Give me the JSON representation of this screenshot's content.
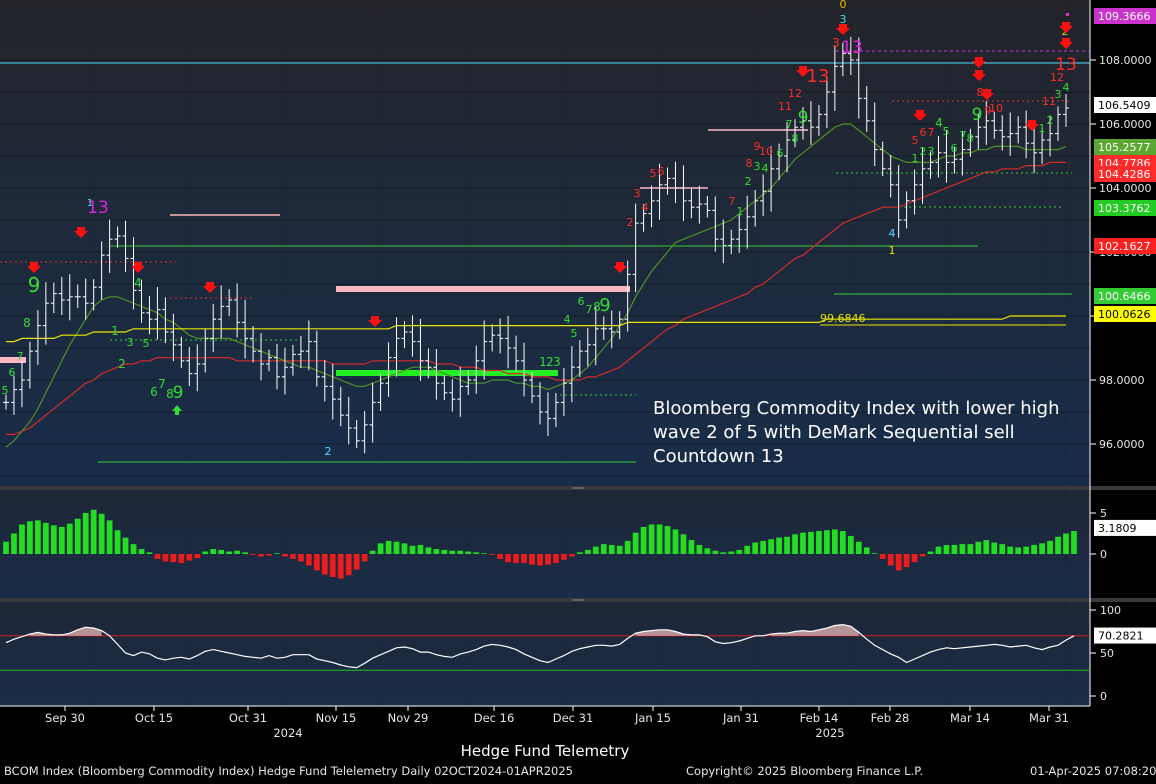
{
  "chart_data": [
    {
      "type": "line",
      "panel": "price",
      "title": "",
      "annotation": "Bloomberg Commodity Index with lower high wave 2 of 5 with DeMark Sequential sell Countdown 13",
      "ylim": [
        95.2,
        110.0
      ],
      "yticks": [
        "96.0000",
        "98.0000",
        "100.0000",
        "102.0000",
        "104.0000",
        "106.0000",
        "108.0000"
      ],
      "price_labels": [
        {
          "value": 109.3666,
          "text": "109.3666",
          "color": "#cc33cc"
        },
        {
          "value": 106.5409,
          "text": "106.5409",
          "color": "#ffffff"
        },
        {
          "value": 105.2577,
          "text": "105.2577",
          "color": "#5aa832"
        },
        {
          "value": 104.7786,
          "text": "104.7786",
          "color": "#ff2a2a"
        },
        {
          "value": 104.4286,
          "text": "104.4286",
          "color": "#ff2a2a"
        },
        {
          "value": 103.3762,
          "text": "103.3762",
          "color": "#22cc22"
        },
        {
          "value": 102.1627,
          "text": "102.1627",
          "color": "#ff2020"
        },
        {
          "value": 100.6466,
          "text": "100.6466",
          "color": "#33cc33"
        },
        {
          "value": 100.0626,
          "text": "100.0626",
          "color": "#ffff00"
        }
      ],
      "inline_label": "99.6846",
      "series": [
        {
          "name": "",
          "color": "#ffffff",
          "values": [
            97.3,
            97.7,
            98.0,
            98.9,
            99.7,
            100.4,
            100.7,
            100.5,
            100.6,
            100.6,
            100.4,
            100.9,
            101.9,
            102.4,
            102.5,
            101.8,
            100.8,
            100.1,
            99.9,
            100.2,
            99.5,
            99.1,
            98.6,
            98.2,
            98.5,
            99.3,
            99.9,
            100.3,
            100.5,
            99.8,
            99.3,
            98.9,
            98.5,
            98.7,
            98.1,
            98.4,
            98.8,
            98.9,
            99.2,
            98.1,
            97.8,
            97.4,
            96.9,
            96.5,
            96.1,
            96.6,
            97.3,
            97.9,
            98.7,
            99.3,
            99.5,
            99.2,
            98.6,
            98.4,
            97.9,
            97.6,
            97.4,
            97.8,
            98.0,
            98.6,
            99.2,
            99.4,
            99.3,
            99.0,
            98.6,
            98.0,
            97.5,
            97.0,
            96.8,
            97.3,
            97.9,
            98.4,
            98.9,
            99.1,
            99.6,
            99.6,
            99.5,
            99.9,
            101.3,
            102.9,
            103.2,
            103.6,
            104.1,
            104.3,
            104.0,
            103.6,
            103.4,
            103.5,
            103.3,
            102.4,
            102.2,
            102.4,
            102.7,
            103.1,
            103.6,
            103.9,
            104.6,
            105.0,
            105.5,
            105.9,
            106.1,
            105.9,
            106.3,
            107.0,
            107.8,
            108.2,
            108.0,
            106.8,
            106.1,
            105.2,
            104.6,
            104.1,
            103.0,
            103.6,
            104.1,
            104.6,
            104.8,
            105.1,
            104.8,
            104.9,
            105.2,
            105.6,
            105.9,
            106.1,
            105.8,
            105.6,
            105.7,
            105.9,
            105.4,
            105.1,
            105.5,
            105.7,
            106.3,
            106.5
          ]
        },
        {
          "name": "",
          "color": "#d32b2b",
          "values": [
            96.3,
            96.3,
            96.4,
            96.5,
            96.7,
            96.9,
            97.1,
            97.3,
            97.5,
            97.7,
            97.9,
            98.0,
            98.2,
            98.3,
            98.4,
            98.5,
            98.5,
            98.6,
            98.6,
            98.7,
            98.7,
            98.7,
            98.7,
            98.7,
            98.7,
            98.7,
            98.7,
            98.7,
            98.7,
            98.6,
            98.6,
            98.6,
            98.6,
            98.6,
            98.6,
            98.6,
            98.6,
            98.6,
            98.6,
            98.6,
            98.6,
            98.5,
            98.5,
            98.5,
            98.5,
            98.5,
            98.6,
            98.6,
            98.6,
            98.6,
            98.6,
            98.6,
            98.6,
            98.6,
            98.5,
            98.5,
            98.5,
            98.4,
            98.4,
            98.4,
            98.3,
            98.3,
            98.3,
            98.2,
            98.2,
            98.2,
            98.1,
            98.1,
            98.1,
            98.0,
            98.0,
            98.0,
            98.0,
            98.1,
            98.1,
            98.2,
            98.3,
            98.4,
            98.6,
            98.8,
            99.0,
            99.2,
            99.4,
            99.6,
            99.7,
            99.9,
            100.0,
            100.1,
            100.2,
            100.3,
            100.4,
            100.5,
            100.6,
            100.7,
            100.9,
            101.0,
            101.2,
            101.4,
            101.6,
            101.8,
            101.9,
            102.1,
            102.3,
            102.5,
            102.7,
            102.9,
            103.0,
            103.1,
            103.2,
            103.3,
            103.4,
            103.4,
            103.4,
            103.5,
            103.6,
            103.7,
            103.8,
            103.9,
            104.0,
            104.1,
            104.2,
            104.3,
            104.4,
            104.5,
            104.5,
            104.6,
            104.6,
            104.6,
            104.7,
            104.7,
            104.7,
            104.8,
            104.8,
            104.8
          ]
        },
        {
          "name": "",
          "color": "#4f8f2a",
          "values": [
            95.9,
            96.1,
            96.4,
            96.7,
            97.1,
            97.6,
            98.1,
            98.6,
            99.1,
            99.5,
            99.9,
            100.3,
            100.5,
            100.6,
            100.6,
            100.5,
            100.4,
            100.3,
            100.2,
            100.1,
            99.9,
            99.8,
            99.6,
            99.4,
            99.3,
            99.3,
            99.3,
            99.3,
            99.3,
            99.2,
            99.1,
            99.0,
            98.9,
            98.8,
            98.7,
            98.6,
            98.5,
            98.4,
            98.4,
            98.3,
            98.2,
            98.1,
            98.0,
            97.9,
            97.8,
            97.8,
            97.9,
            98.0,
            98.1,
            98.2,
            98.3,
            98.4,
            98.4,
            98.4,
            98.3,
            98.2,
            98.1,
            98.0,
            97.9,
            97.9,
            97.9,
            98.0,
            98.0,
            98.0,
            97.9,
            97.9,
            97.8,
            97.8,
            97.7,
            97.8,
            97.9,
            98.0,
            98.2,
            98.4,
            98.7,
            99.0,
            99.3,
            99.7,
            100.1,
            100.6,
            101.0,
            101.4,
            101.7,
            102.0,
            102.3,
            102.4,
            102.5,
            102.6,
            102.7,
            102.8,
            102.9,
            103.0,
            103.2,
            103.4,
            103.6,
            103.8,
            104.0,
            104.3,
            104.6,
            104.9,
            105.1,
            105.3,
            105.5,
            105.7,
            105.9,
            106.0,
            106.0,
            105.8,
            105.6,
            105.4,
            105.2,
            105.0,
            104.9,
            104.8,
            104.8,
            104.8,
            104.8,
            104.9,
            105.0,
            105.0,
            105.1,
            105.1,
            105.2,
            105.2,
            105.3,
            105.3,
            105.3,
            105.3,
            105.2,
            105.2,
            105.2,
            105.2,
            105.2,
            105.3
          ]
        },
        {
          "name": "",
          "color": "#e6e600",
          "values": [
            99.2,
            99.2,
            99.3,
            99.3,
            99.3,
            99.3,
            99.3,
            99.4,
            99.4,
            99.4,
            99.4,
            99.5,
            99.5,
            99.5,
            99.5,
            99.5,
            99.6,
            99.6,
            99.6,
            99.6,
            99.6,
            99.6,
            99.6,
            99.6,
            99.6,
            99.6,
            99.6,
            99.6,
            99.6,
            99.6,
            99.6,
            99.6,
            99.6,
            99.6,
            99.6,
            99.6,
            99.6,
            99.6,
            99.6,
            99.6,
            99.6,
            99.6,
            99.6,
            99.6,
            99.6,
            99.6,
            99.6,
            99.6,
            99.6,
            99.7,
            99.7,
            99.7,
            99.7,
            99.7,
            99.7,
            99.7,
            99.7,
            99.7,
            99.7,
            99.7,
            99.7,
            99.7,
            99.7,
            99.7,
            99.7,
            99.7,
            99.7,
            99.7,
            99.7,
            99.7,
            99.7,
            99.7,
            99.7,
            99.7,
            99.7,
            99.7,
            99.7,
            99.7,
            99.8,
            99.8,
            99.8,
            99.8,
            99.8,
            99.8,
            99.8,
            99.8,
            99.8,
            99.8,
            99.8,
            99.8,
            99.8,
            99.8,
            99.8,
            99.8,
            99.8,
            99.8,
            99.8,
            99.8,
            99.8,
            99.8,
            99.8,
            99.8,
            99.8,
            99.9,
            99.9,
            99.9,
            99.9,
            99.9,
            99.9,
            99.9,
            99.9,
            99.9,
            99.9,
            99.9,
            99.9,
            99.9,
            99.9,
            99.9,
            99.9,
            99.9,
            99.9,
            99.9,
            99.9,
            99.9,
            99.9,
            99.9,
            100.0,
            100.0,
            100.0,
            100.0,
            100.0,
            100.0,
            100.0,
            100.0
          ]
        }
      ]
    },
    {
      "type": "bar",
      "panel": "oscillator",
      "ylim": [
        -5,
        7
      ],
      "yticks": [
        "5",
        "0"
      ],
      "price_label": "3.1809",
      "values": [
        1.5,
        2.5,
        3.6,
        4.0,
        4.1,
        3.8,
        3.5,
        3.3,
        3.7,
        4.3,
        5.0,
        5.4,
        4.9,
        4.1,
        2.9,
        2.0,
        1.2,
        0.6,
        0.2,
        -0.6,
        -0.9,
        -1.0,
        -1.1,
        -0.8,
        -0.5,
        0.3,
        0.6,
        0.5,
        0.3,
        0.4,
        0.2,
        -0.1,
        -0.3,
        -0.2,
        0.1,
        -0.3,
        -0.6,
        -0.9,
        -1.4,
        -2.0,
        -2.5,
        -2.8,
        -3.0,
        -2.6,
        -1.9,
        -0.9,
        0.4,
        1.3,
        1.6,
        1.5,
        1.3,
        1.0,
        1.1,
        0.8,
        0.6,
        0.5,
        0.4,
        0.4,
        0.3,
        0.2,
        0.1,
        -0.1,
        -0.6,
        -1.0,
        -1.1,
        -1.1,
        -1.3,
        -1.4,
        -1.3,
        -1.1,
        -0.7,
        -0.3,
        0.2,
        0.5,
        0.9,
        1.2,
        1.1,
        1.0,
        1.6,
        2.6,
        3.3,
        3.6,
        3.6,
        3.4,
        3.0,
        2.4,
        1.7,
        1.1,
        0.7,
        0.4,
        0.2,
        0.3,
        0.5,
        1.0,
        1.4,
        1.6,
        1.8,
        2.0,
        2.1,
        2.4,
        2.6,
        2.7,
        2.8,
        2.9,
        3.0,
        2.8,
        2.2,
        1.5,
        0.8,
        0.1,
        -0.6,
        -1.4,
        -2.0,
        -1.6,
        -1.0,
        -0.3,
        0.3,
        0.9,
        1.1,
        1.1,
        1.2,
        1.2,
        1.5,
        1.7,
        1.4,
        1.2,
        0.9,
        0.8,
        0.9,
        1.1,
        1.3,
        1.6,
        2.1,
        2.5,
        2.8
      ]
    },
    {
      "type": "line",
      "panel": "rsi",
      "ylim": [
        -5,
        105
      ],
      "yticks": [
        "100",
        "50",
        "0"
      ],
      "price_label": "70.2821",
      "reference_lines": [
        70,
        30
      ],
      "values": [
        62,
        66,
        69,
        72,
        74,
        72,
        71,
        71,
        73,
        77,
        80,
        79,
        76,
        70,
        60,
        50,
        47,
        51,
        49,
        44,
        42,
        44,
        45,
        43,
        47,
        52,
        54,
        52,
        50,
        48,
        46,
        45,
        44,
        47,
        44,
        45,
        48,
        48,
        48,
        43,
        41,
        39,
        36,
        34,
        33,
        38,
        44,
        48,
        52,
        56,
        57,
        55,
        51,
        51,
        48,
        46,
        45,
        49,
        51,
        54,
        58,
        60,
        59,
        57,
        54,
        49,
        45,
        41,
        39,
        43,
        47,
        52,
        55,
        57,
        59,
        59,
        58,
        60,
        67,
        73,
        75,
        76,
        77,
        77,
        75,
        72,
        71,
        71,
        69,
        63,
        61,
        62,
        64,
        67,
        70,
        70,
        72,
        73,
        73,
        75,
        76,
        75,
        77,
        79,
        82,
        83,
        81,
        74,
        66,
        59,
        54,
        49,
        45,
        39,
        43,
        47,
        51,
        54,
        56,
        55,
        56,
        57,
        58,
        59,
        60,
        59,
        57,
        58,
        59,
        56,
        54,
        57,
        59,
        65,
        70
      ]
    }
  ],
  "x_axis": {
    "labels": [
      "Sep 30",
      "Oct 15",
      "Oct 31",
      "Nov 15",
      "Nov 29",
      "Dec 16",
      "Dec 31",
      "Jan 15",
      "Jan 31",
      "Feb 14",
      "Feb 28",
      "Mar 14",
      "Mar 31"
    ],
    "years": [
      "2024",
      "2025"
    ]
  },
  "subtitle": "Hedge Fund Telemetry",
  "footer": {
    "left": "BCOM Index (Bloomberg Commodity Index) Hedge Fund Telelemetry  Daily 02OCT2024-01APR2025",
    "center": "Copyright© 2025 Bloomberg Finance L.P.",
    "right": "01-Apr-2025 07:08:20"
  },
  "colors": {
    "background_top": "#22232a",
    "background_bottom": "#1a2b47",
    "buy_count": "#33dd33",
    "sell_count": "#ff2a2a",
    "countdown": "#dd22dd",
    "tdst": "#ffb6c1"
  }
}
